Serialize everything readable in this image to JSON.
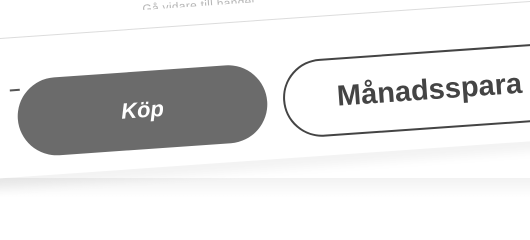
{
  "header": {
    "partial_text": "Gå vidare till handel"
  },
  "actions": {
    "buy_label": "Köp",
    "monthly_savings_label": "Månadsspara"
  }
}
